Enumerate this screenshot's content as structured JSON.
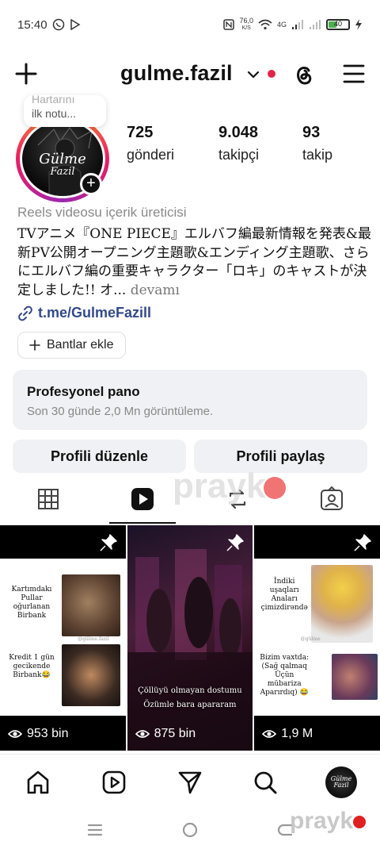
{
  "status_bar": {
    "time": "15:40",
    "net_speed": "76,0",
    "net_unit": "K/S",
    "network": "4G",
    "battery": "40",
    "battery_level": 0.4
  },
  "header": {
    "username": "gulme.fazil"
  },
  "profile": {
    "note_line1": "Hartarını",
    "note_line2": "ilk notu...",
    "avatar_text_line1": "Gülme",
    "avatar_text_line2": "Fazil",
    "stats": [
      {
        "value": "725",
        "label": "gönderi"
      },
      {
        "value": "9.048",
        "label": "takipçi"
      },
      {
        "value": "93",
        "label": "takip"
      }
    ],
    "category": "Reels videosu içerik üreticisi",
    "bio": "TVアニメ『ONE PIECE』エルバフ編最新情報を発表&最新PV公開オープニング主題歌&エンディング主題歌、さらにエルバフ編の重要キャラクター「ロキ」のキャストが決定しました!! オ...",
    "bio_more": "devamı",
    "link": "t.me/GulmeFazill",
    "highlights_chip": "Bantlar ekle"
  },
  "pro_dashboard": {
    "title": "Profesyonel pano",
    "subtitle": "Son 30 günde 2,0 Mn görüntüleme."
  },
  "actions": {
    "edit_profile": "Profili düzenle",
    "share_profile": "Profili paylaş"
  },
  "watermark": "prayk",
  "reels": [
    {
      "views": "953 bin",
      "caption_top": "Kartımdakı Pullar oğurlanan Birbank",
      "caption_bottom": "Kredit 1 gün gecikende Birbank😂",
      "small_tag": "@gülme.fazil"
    },
    {
      "views": "875 bin",
      "caption": "Çöllüyü olmayan dostumu Özümle bara apararam"
    },
    {
      "views": "1,9 M",
      "caption_top": "İndiki uşaqları Anaları çimizdirəndə",
      "caption_bottom": "Bizim vaxtda: (Sağ qalmaq Üçün mübariza Aparırdıq) 😂",
      "small_tag": "@gülme"
    }
  ],
  "icons": {
    "create": "plus-icon",
    "threads": "threads-icon",
    "menu": "hamburger-menu-icon",
    "link": "link-icon",
    "pin": "pin-icon",
    "views": "eye-icon"
  },
  "colors": {
    "accent_red": "#e0244a",
    "link_blue": "#334b8a",
    "surface": "#eff1f5"
  }
}
